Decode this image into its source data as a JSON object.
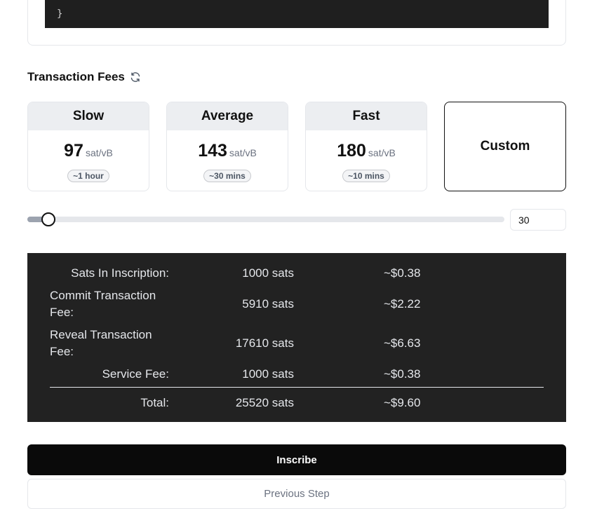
{
  "code_block": {
    "line_partial": "  }",
    "line_close": "}"
  },
  "fees": {
    "title": "Transaction Fees",
    "refresh_icon": "refresh-icon",
    "options": [
      {
        "name": "Slow",
        "rate": "97",
        "unit": "sat/vB",
        "eta": "~1 hour"
      },
      {
        "name": "Average",
        "rate": "143",
        "unit": "sat/vB",
        "eta": "~30 mins"
      },
      {
        "name": "Fast",
        "rate": "180",
        "unit": "sat/vB",
        "eta": "~10 mins"
      }
    ],
    "custom_label": "Custom",
    "custom_selected": true
  },
  "slider": {
    "value": "30",
    "min": 1,
    "max": 1000,
    "fraction": 0.03
  },
  "summary": {
    "rows": [
      {
        "label": "Sats In Inscription:",
        "sats": "1000 sats",
        "usd": "~$0.38"
      },
      {
        "label": "Commit Transaction Fee:",
        "sats": "5910 sats",
        "usd": "~$2.22"
      },
      {
        "label": "Reveal Transaction Fee:",
        "sats": "17610 sats",
        "usd": "~$6.63"
      },
      {
        "label": "Service Fee:",
        "sats": "1000 sats",
        "usd": "~$0.38"
      }
    ],
    "total": {
      "label": "Total:",
      "sats": "25520 sats",
      "usd": "~$9.60"
    }
  },
  "actions": {
    "inscribe_label": "Inscribe",
    "previous_label": "Previous Step"
  },
  "colors": {
    "summary_bg": "#222222",
    "primary_button": "#0a0a0a",
    "card_header": "#eceef1"
  }
}
